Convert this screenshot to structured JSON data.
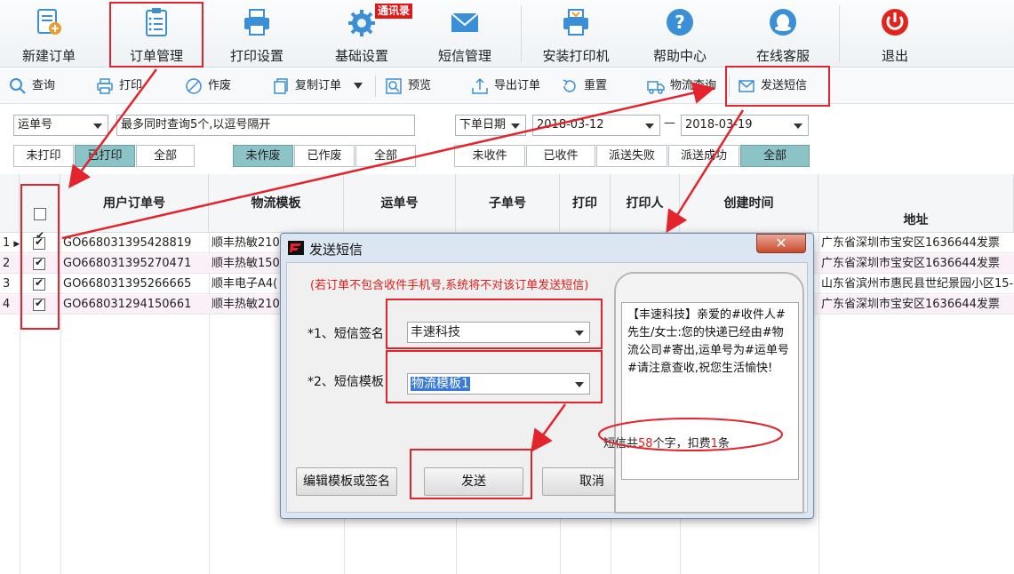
{
  "ribbon": {
    "buttons": [
      {
        "label": "新建订单",
        "icon": "new-order-icon"
      },
      {
        "label": "订单管理",
        "icon": "clipboard-icon"
      },
      {
        "label": "打印设置",
        "icon": "printer-icon"
      },
      {
        "label": "基础设置",
        "icon": "gear-icon"
      },
      {
        "label": "短信管理",
        "icon": "envelope-icon"
      },
      {
        "label": "安装打印机",
        "icon": "install-printer-icon"
      },
      {
        "label": "帮助中心",
        "icon": "help-icon"
      },
      {
        "label": "在线客服",
        "icon": "chat-icon"
      },
      {
        "label": "退出",
        "icon": "power-icon"
      }
    ],
    "badge": "通讯录"
  },
  "toolbar": {
    "items": [
      "查询",
      "打印",
      "作废",
      "复制订单",
      "预览",
      "导出订单",
      "重置",
      "物流查询",
      "发送短信"
    ]
  },
  "filters": {
    "search_type": "运单号",
    "search_placeholder": "最多同时查询5个,以逗号隔开",
    "date_type": "下单日期",
    "date_from": "2018-03-12",
    "date_sep": "—",
    "date_to": "2018-03-19",
    "print_status": [
      "未打印",
      "已打印",
      "全部"
    ],
    "void_status": [
      "未作废",
      "已作废",
      "全部"
    ],
    "delivery_status": [
      "未收件",
      "已收件",
      "派送失败",
      "派送成功",
      "全部"
    ]
  },
  "grid": {
    "columns": [
      "用户订单号",
      "物流模板",
      "运单号",
      "子单号",
      "打印",
      "打印人",
      "创建时间",
      "地址"
    ],
    "rows": [
      {
        "num": "1",
        "order": "GO668031395428819",
        "template": "顺丰热敏210",
        "address": "广东省深圳市宝安区1636644发票"
      },
      {
        "num": "2",
        "order": "GO668031395270471",
        "template": "顺丰热敏150",
        "address": "广东省深圳市宝安区1636644发票"
      },
      {
        "num": "3",
        "order": "GO668031395266665",
        "template": "顺丰电子A4(",
        "address": "山东省滨州市惠民县世纪景园小区15-"
      },
      {
        "num": "4",
        "order": "GO668031294150661",
        "template": "顺丰热敏210",
        "address": "广东省深圳市宝安区1636644发票"
      }
    ]
  },
  "dialog": {
    "title": "发送短信",
    "close_glyph": "✕",
    "notice": "(若订单不包含收件手机号,系统将不对该订单发送短信)",
    "signature_label": "*1、短信签名",
    "signature_value": "丰速科技",
    "template_label": "*2、短信模板",
    "template_value": "物流模板1",
    "preview_text": "【丰速科技】亲爱的#收件人#先生/女士:您的快递已经由#物流公司#寄出,运单号为#运单号#请注意查收,祝您生活愉快!",
    "count_prefix": "短信共",
    "count_chars": "58",
    "count_mid": "个字，扣费",
    "count_msgs": "1",
    "count_suffix": "条",
    "edit_button": "编辑模板或签名",
    "send_button": "发送",
    "cancel_button": "取消"
  },
  "colors": {
    "annotation_red": "#e4242c",
    "toggle_active": "#8cc3c6",
    "row_alt": "#fbf0f7",
    "notice_red": "#e0201a"
  }
}
